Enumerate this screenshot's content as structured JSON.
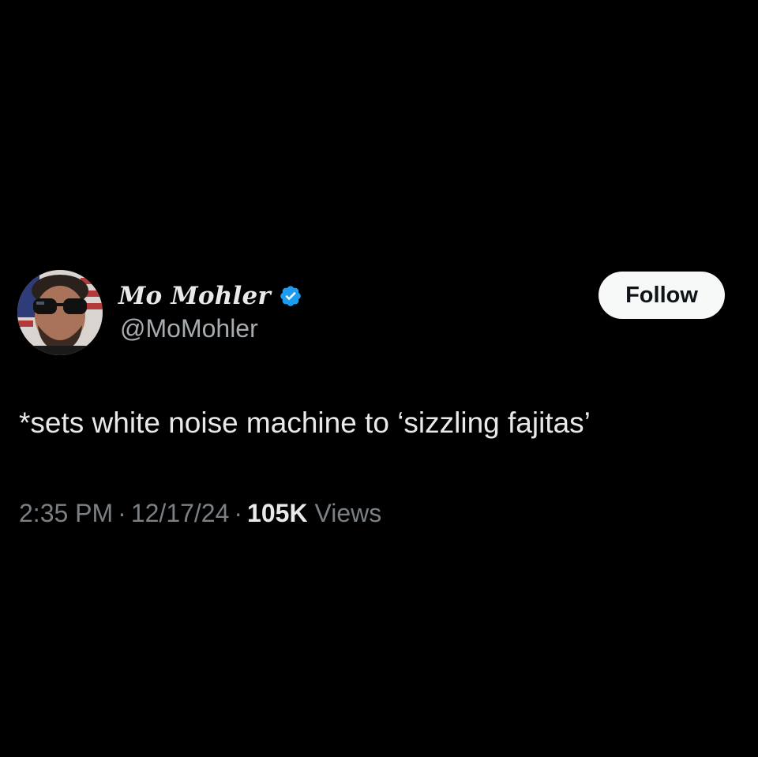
{
  "tweet": {
    "author": {
      "display_name": "Mo Mohler",
      "handle": "@MoMohler",
      "verified": true,
      "avatar_icon": "profile-photo-avatar",
      "verified_icon": "verified-badge-icon"
    },
    "follow_label": "Follow",
    "text": "*sets white noise machine to ‘sizzling fajitas’",
    "meta": {
      "time": "2:35 PM",
      "separator": "·",
      "date": "12/17/24",
      "views_count": "105K",
      "views_label": "Views"
    }
  },
  "colors": {
    "background": "#000000",
    "primary_text": "#e7e9ea",
    "secondary_text": "#7b8084",
    "verified_blue": "#1d9bf0",
    "button_bg": "#f7f9f9",
    "button_text": "#0f1419"
  }
}
